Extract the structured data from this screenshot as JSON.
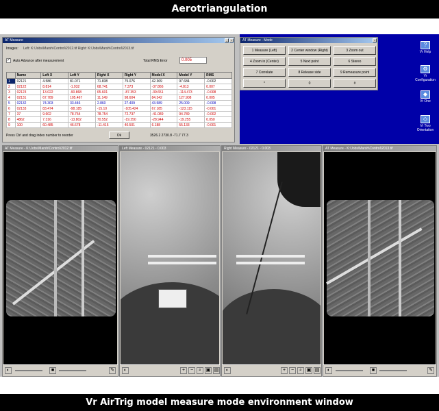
{
  "top_banner": "Aerotriangulation",
  "bottom_banner": "Vr AirTrig model measure mode environment window",
  "measure_window": {
    "title": "AT Measure",
    "images_label": "Images:",
    "images_value": "Left: K:\\Jobs\\Marsh\\Control\\2012.tif   Right: K:\\Jobs\\Marsh\\Control\\2013.tif",
    "auto_advance_label": "Auto Advance after measurement",
    "total_rms_label": "Total RMS Error",
    "total_rms_value": "0.005",
    "columns": [
      "Name",
      "Left X",
      "Left Y",
      "Right X",
      "Right Y",
      "Model X",
      "Model Y",
      "RMS"
    ],
    "rows": [
      {
        "idx": "1",
        "cells": [
          "02121",
          "4.586",
          "81.071",
          "71.838",
          "75.076",
          "42.369",
          "97.684",
          "-0.002"
        ],
        "color": "norm"
      },
      {
        "idx": "2",
        "cells": [
          "02122",
          "8.814",
          "-1.932",
          "68.741",
          "7.373",
          "-37.866",
          "-4.813",
          "0.007"
        ],
        "color": "red"
      },
      {
        "idx": "3",
        "cells": [
          "02123",
          "13.022",
          "-90.868",
          "65.601",
          "-87.353",
          "-39.651",
          "-114.473",
          "-0.008"
        ],
        "color": "red"
      },
      {
        "idx": "4",
        "cells": [
          "02131",
          "67.789",
          "105.467",
          "11.149",
          "98.604",
          "84.342",
          "127.908",
          "0.005"
        ],
        "color": "red"
      },
      {
        "idx": "5",
        "cells": [
          "02132",
          "74.303",
          "33.446",
          "2.860",
          "27.409",
          "43.589",
          "25.009",
          "-0.008"
        ],
        "color": "blue"
      },
      {
        "idx": "6",
        "cells": [
          "02133",
          "83.474",
          "-98.185",
          "-15.10",
          "-105.424",
          "67.185",
          "-123.115",
          "-0.001"
        ],
        "color": "red"
      },
      {
        "idx": "7",
        "cells": [
          "37",
          "9.602",
          "78.754",
          "78.754",
          "72.737",
          "-41.089",
          "94.789",
          "-0.002"
        ],
        "color": "red"
      },
      {
        "idx": "8",
        "cells": [
          "4862",
          "7.316",
          "-13.802",
          "70.552",
          "-19.250",
          "-28.944",
          "-19.255",
          "0.050"
        ],
        "color": "red"
      },
      {
        "idx": "9",
        "cells": [
          "100",
          "60.485",
          "46.678",
          "-11.415",
          "40.501",
          "6.188",
          "55.133",
          "-0.001"
        ],
        "color": "red"
      }
    ],
    "hint": "Press Ctrl and drag index number to reorder",
    "ok_label": "Ok",
    "coords": "3526.2  2730.8    -71.7  77.3"
  },
  "mode_window": {
    "title": "AT Measure - Mode",
    "buttons": [
      "1 Measure (Left)",
      "2 Center window (Right)",
      "3 Zoom out",
      "4 Zoom in (Center)",
      "5 Next point",
      "6 Stereo",
      "7 Correlate",
      "8 Release side",
      "9 Remeasure point",
      "*",
      "0",
      "#"
    ]
  },
  "desktop_icons": [
    {
      "label": "Vr Help",
      "icon": "help-icon"
    },
    {
      "label": "Vr Configuration",
      "icon": "configuration-icon"
    },
    {
      "label": "Vr One",
      "icon": "vr-one-icon"
    },
    {
      "label": "Vr Two Orientation",
      "icon": "vr-two-icon"
    }
  ],
  "image_windows": [
    {
      "title": "AT Measure - K:\\Jobs\\Marsh\\Control\\2012.tif"
    },
    {
      "title": "Left Measure - 02121 - 0.003"
    },
    {
      "title": "Right Measure - 02121 - 0.003"
    },
    {
      "title": "AT Measure - K:\\Jobs\\Marsh\\Control\\2013.tif"
    }
  ]
}
